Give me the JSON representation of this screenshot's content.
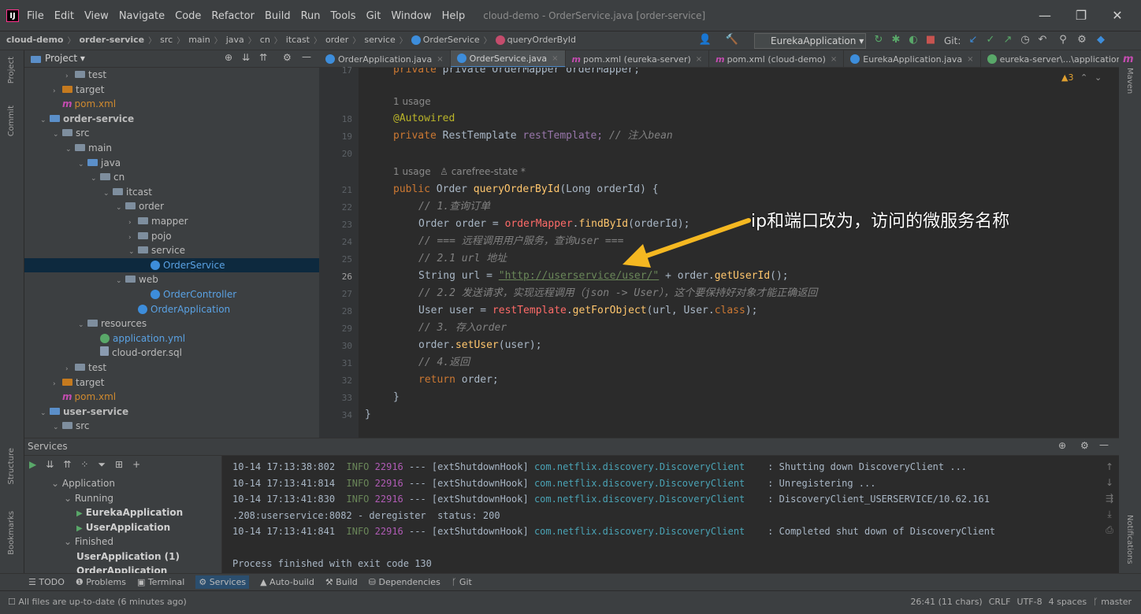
{
  "app": {
    "logo": "IJ",
    "menus": [
      "File",
      "Edit",
      "View",
      "Navigate",
      "Code",
      "Refactor",
      "Build",
      "Run",
      "Tools",
      "Git",
      "Window",
      "Help"
    ],
    "window_title": "cloud-demo - OrderService.java [order-service]",
    "minimize": "—",
    "maximize": "❐",
    "close": "✕"
  },
  "breadcrumb": [
    "cloud-demo",
    "order-service",
    "src",
    "main",
    "java",
    "cn",
    "itcast",
    "order",
    "service",
    "OrderService",
    "queryOrderById"
  ],
  "toolbar": {
    "run_config": "EurekaApplication",
    "git_label": "Git:"
  },
  "left_stripe": [
    "Project",
    "Commit",
    "Structure",
    "Bookmarks"
  ],
  "right_stripe": [
    "Maven",
    "Notifications"
  ],
  "project": {
    "header": "Project",
    "rows": [
      {
        "label": "test",
        "indent": 3,
        "kind": "folder",
        "arrow": "›"
      },
      {
        "label": "target",
        "indent": 2,
        "kind": "folder-orange",
        "arrow": "›"
      },
      {
        "label": "pom.xml",
        "indent": 2,
        "kind": "maven",
        "arrow": ""
      },
      {
        "label": "order-service",
        "indent": 1,
        "kind": "folder-module",
        "arrow": "⌄",
        "bold": true
      },
      {
        "label": "src",
        "indent": 2,
        "kind": "folder",
        "arrow": "⌄"
      },
      {
        "label": "main",
        "indent": 3,
        "kind": "folder",
        "arrow": "⌄"
      },
      {
        "label": "java",
        "indent": 4,
        "kind": "folder-blue",
        "arrow": "⌄"
      },
      {
        "label": "cn",
        "indent": 5,
        "kind": "folder",
        "arrow": "⌄"
      },
      {
        "label": "itcast",
        "indent": 6,
        "kind": "folder",
        "arrow": "⌄"
      },
      {
        "label": "order",
        "indent": 7,
        "kind": "folder",
        "arrow": "⌄"
      },
      {
        "label": "mapper",
        "indent": 8,
        "kind": "folder",
        "arrow": "›"
      },
      {
        "label": "pojo",
        "indent": 8,
        "kind": "folder",
        "arrow": "›"
      },
      {
        "label": "service",
        "indent": 8,
        "kind": "folder",
        "arrow": "⌄"
      },
      {
        "label": "OrderService",
        "indent": 9,
        "kind": "class",
        "arrow": "",
        "selected": true
      },
      {
        "label": "web",
        "indent": 7,
        "kind": "folder",
        "arrow": "⌄"
      },
      {
        "label": "OrderController",
        "indent": 9,
        "kind": "class",
        "arrow": ""
      },
      {
        "label": "OrderApplication",
        "indent": 8,
        "kind": "class",
        "arrow": ""
      },
      {
        "label": "resources",
        "indent": 4,
        "kind": "folder",
        "arrow": "⌄"
      },
      {
        "label": "application.yml",
        "indent": 5,
        "kind": "yml",
        "arrow": ""
      },
      {
        "label": "cloud-order.sql",
        "indent": 5,
        "kind": "sql",
        "arrow": ""
      },
      {
        "label": "test",
        "indent": 3,
        "kind": "folder",
        "arrow": "›"
      },
      {
        "label": "target",
        "indent": 2,
        "kind": "folder-orange",
        "arrow": "›"
      },
      {
        "label": "pom.xml",
        "indent": 2,
        "kind": "maven",
        "arrow": ""
      },
      {
        "label": "user-service",
        "indent": 1,
        "kind": "folder-module",
        "arrow": "⌄",
        "bold": true
      },
      {
        "label": "src",
        "indent": 2,
        "kind": "folder",
        "arrow": "⌄"
      }
    ]
  },
  "tabs": [
    {
      "label": "OrderApplication.java"
    },
    {
      "label": "OrderService.java",
      "active": true
    },
    {
      "label": "pom.xml (eureka-server)"
    },
    {
      "label": "pom.xml (cloud-demo)"
    },
    {
      "label": "EurekaApplication.java"
    },
    {
      "label": "eureka-server\\...\\application.yml"
    },
    {
      "label": "pom"
    }
  ],
  "editor": {
    "warnings": "▲3",
    "line_numbers": [
      "17",
      "",
      "18",
      "19",
      "20",
      "",
      "21",
      "22",
      "23",
      "24",
      "25",
      "26",
      "27",
      "28",
      "29",
      "30",
      "31",
      "32",
      "33",
      "34"
    ],
    "hint_usage": "1 usage",
    "hint_author": "carefree-state *",
    "top_line": "private OrderMapper orderMapper;",
    "autowired": "@Autowired",
    "rt_private": "private",
    "rt_type": "RestTemplate",
    "rt_field": "restTemplate;",
    "rt_comment": "// 注入bean",
    "m_public": "public",
    "m_type": "Order",
    "m_name": "queryOrderById",
    "m_params": "(Long orderId) {",
    "c1": "// 1.查询订单",
    "l23_a": "Order order = ",
    "l23_b": "orderMapper",
    "l23_c": ".",
    "l23_d": "findById",
    "l23_e": "(orderId);",
    "c2": "// === 远程调用用户服务，查询user ===",
    "c3": "// 2.1 url 地址",
    "l26_a": "String url = ",
    "l26_b": "\"http://userservice/user/\"",
    "l26_c": " + order.",
    "l26_d": "getUserId",
    "l26_e": "();",
    "c4": "// 2.2 发送请求，实现远程调用（json -> User），这个要保持好对象才能正确返回",
    "l28_a": "User user = ",
    "l28_b": "restTemplate",
    "l28_c": ".",
    "l28_d": "getForObject",
    "l28_e": "(url, User.",
    "l28_f": "class",
    "l28_g": ");",
    "c5": "// 3. 存入order",
    "l30_a": "order.",
    "l30_b": "setUser",
    "l30_c": "(user);",
    "c6": "// 4.返回",
    "ret_kw": "return",
    "ret_rest": " order;",
    "close1": "}",
    "close2": "}"
  },
  "annotation": "ip和端口改为，访问的微服务名称",
  "services": {
    "title": "Services",
    "tree": [
      {
        "label": "Application",
        "indent": 1,
        "arrow": "⌄"
      },
      {
        "label": "Running",
        "indent": 2,
        "arrow": "⌄"
      },
      {
        "label": "EurekaApplication",
        "indent": 3,
        "arrow": "",
        "bold": true,
        "run": true
      },
      {
        "label": "UserApplication",
        "indent": 3,
        "arrow": "",
        "bold": true,
        "run": true
      },
      {
        "label": "Finished",
        "indent": 2,
        "arrow": "⌄"
      },
      {
        "label": "UserApplication (1)",
        "indent": 3,
        "arrow": "",
        "bold": true
      },
      {
        "label": "OrderApplication",
        "indent": 3,
        "arrow": "",
        "bold": true
      }
    ],
    "logs": [
      {
        "time": "10-14 17:13:38:802",
        "level": "INFO",
        "pid": "22916",
        "thread": "--- [extShutdownHook]",
        "cls": "com.netflix.discovery.DiscoveryClient",
        "msg": ": Shutting down DiscoveryClient ..."
      },
      {
        "time": "10-14 17:13:41:814",
        "level": "INFO",
        "pid": "22916",
        "thread": "--- [extShutdownHook]",
        "cls": "com.netflix.discovery.DiscoveryClient",
        "msg": ": Unregistering ..."
      },
      {
        "time": "10-14 17:13:41:830",
        "level": "INFO",
        "pid": "22916",
        "thread": "--- [extShutdownHook]",
        "cls": "com.netflix.discovery.DiscoveryClient",
        "msg": ": DiscoveryClient_USERSERVICE/10.62.161"
      },
      {
        "time": "",
        "level": "",
        "pid": "",
        "thread": "",
        "cls": "",
        "msg": ".208:userservice:8082 - deregister  status: 200"
      },
      {
        "time": "10-14 17:13:41:841",
        "level": "INFO",
        "pid": "22916",
        "thread": "--- [extShutdownHook]",
        "cls": "com.netflix.discovery.DiscoveryClient",
        "msg": ": Completed shut down of DiscoveryClient"
      },
      {
        "time": "",
        "level": "",
        "pid": "",
        "thread": "",
        "cls": "",
        "msg": ""
      },
      {
        "time": "",
        "level": "",
        "pid": "",
        "thread": "",
        "cls": "",
        "msg": "Process finished with exit code 130"
      }
    ]
  },
  "bottom_tools": [
    "TODO",
    "Problems",
    "Terminal",
    "Services",
    "Auto-build",
    "Build",
    "Dependencies",
    "Git"
  ],
  "status": {
    "left": "All files are up-to-date (6 minutes ago)",
    "position": "26:41 (11 chars)",
    "line_sep": "CRLF",
    "encoding": "UTF-8",
    "indent": "4 spaces",
    "branch": "master"
  }
}
